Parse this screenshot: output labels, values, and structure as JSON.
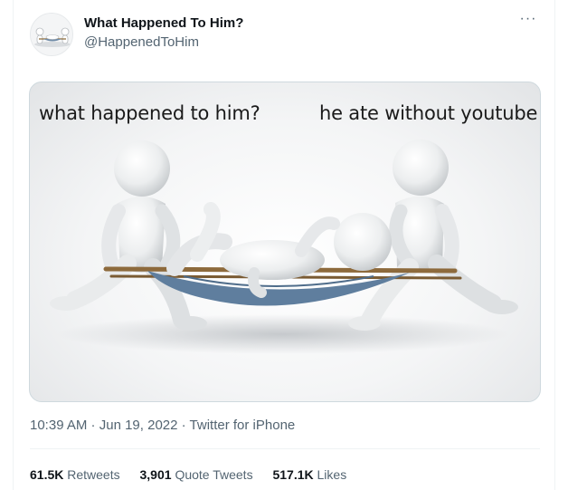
{
  "author": {
    "display_name": "What Happened To Him?",
    "handle": "@HappenedToHim",
    "avatar_icon": "stretcher-figures-avatar"
  },
  "more_icon": "more-options-icon",
  "more_glyph": "···",
  "media": {
    "caption_left": "what happened to him?",
    "caption_right": "he ate without youtube"
  },
  "meta": {
    "time": "10:39 AM",
    "sep1": " · ",
    "date": "Jun 19, 2022",
    "sep2": " · ",
    "source": "Twitter for iPhone"
  },
  "stats": {
    "retweets_count": "61.5K",
    "retweets_label": "Retweets",
    "quote_count": "3,901",
    "quote_label": "Quote Tweets",
    "likes_count": "517.1K",
    "likes_label": "Likes"
  },
  "colors": {
    "text_primary": "#0f1419",
    "text_secondary": "#536471",
    "border": "#cfd9de"
  }
}
